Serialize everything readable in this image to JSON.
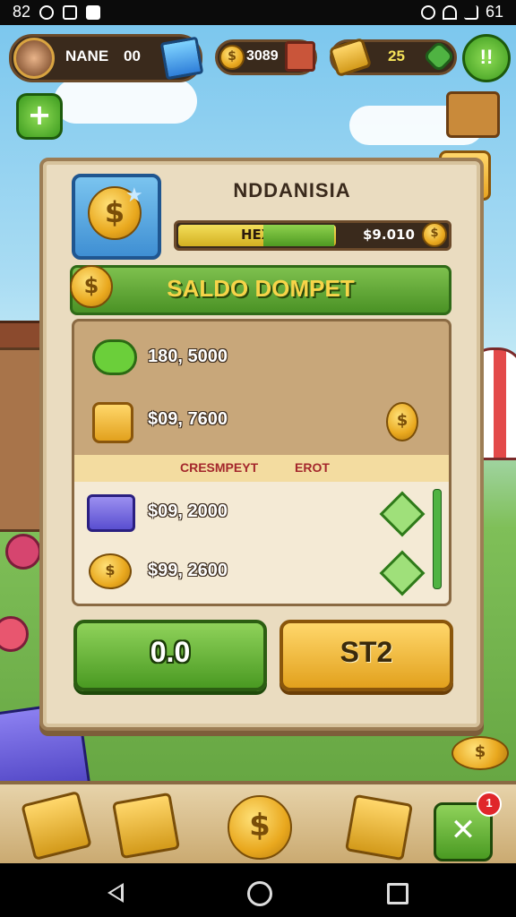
{
  "status_bar": {
    "time": "82",
    "battery": "61"
  },
  "hud": {
    "player_name": "NANE",
    "player_level": "00",
    "coins": "3089",
    "cards": "25",
    "pause_label": "!!"
  },
  "panel": {
    "title": "NDDANISIA",
    "xp_label": "HEX",
    "xp_value": "$9.010",
    "xp_progress": 0.58,
    "banner": "SALDO DOMPET",
    "top_rows": [
      {
        "icon": "green-creature-icon",
        "value": "180, 5000"
      },
      {
        "icon": "gold-token-icon",
        "value": "$09, 7600"
      }
    ],
    "column_headers": [
      "CRESMPEYT",
      "EROT"
    ],
    "bottom_rows": [
      {
        "icon": "purple-block-icon",
        "value": "$09, 2000"
      },
      {
        "icon": "coin-stack-icon",
        "value": "$99, 2600"
      }
    ],
    "btn_left": "0.0",
    "btn_right": "ST2"
  },
  "bottom_bar": {
    "notif_count": "1"
  },
  "icons": {
    "coin_symbol": "$",
    "plus": "+",
    "close": "✕"
  },
  "colors": {
    "accent_green": "#4a9a22",
    "accent_gold": "#e2a11d",
    "panel": "#eadcc0"
  }
}
